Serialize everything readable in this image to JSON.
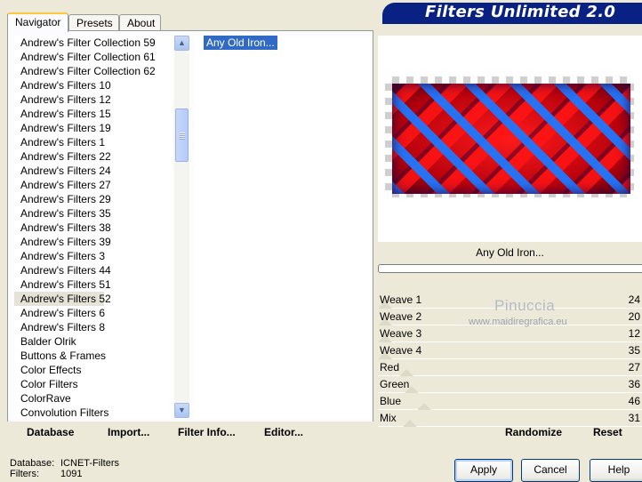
{
  "app": {
    "title": "Filters Unlimited 2.0"
  },
  "tabs": [
    {
      "label": "Navigator",
      "active": true
    },
    {
      "label": "Presets",
      "active": false
    },
    {
      "label": "About",
      "active": false
    }
  ],
  "categories": {
    "items": [
      "Andrew's Filter Collection 59",
      "Andrew's Filter Collection 61",
      "Andrew's Filter Collection 62",
      "Andrew's Filters 10",
      "Andrew's Filters 12",
      "Andrew's Filters 15",
      "Andrew's Filters 19",
      "Andrew's Filters 1",
      "Andrew's Filters 22",
      "Andrew's Filters 24",
      "Andrew's Filters 27",
      "Andrew's Filters 29",
      "Andrew's Filters 35",
      "Andrew's Filters 38",
      "Andrew's Filters 39",
      "Andrew's Filters 3",
      "Andrew's Filters 44",
      "Andrew's Filters 51",
      "Andrew's Filters 52",
      "Andrew's Filters 6",
      "Andrew's Filters 8",
      "Balder Olrik",
      "Buttons & Frames",
      "Color Effects",
      "Color Filters",
      "ColorRave",
      "Convolution Filters"
    ],
    "selected": "Andrew's Filters 52"
  },
  "filters": {
    "items": [
      "Any Old Iron..."
    ],
    "selected": "Any Old Iron..."
  },
  "left_buttons": {
    "database": "Database",
    "import": "Import...",
    "filter_info": "Filter Info...",
    "editor": "Editor..."
  },
  "preview": {
    "filter_name": "Any Old Iron..."
  },
  "parameters": [
    {
      "label": "Weave 1",
      "value": "24"
    },
    {
      "label": "Weave 2",
      "value": "20"
    },
    {
      "label": "Weave 3",
      "value": "12"
    },
    {
      "label": "Weave 4",
      "value": "35"
    },
    {
      "label": "Red",
      "value": "27"
    },
    {
      "label": "Green",
      "value": "36"
    },
    {
      "label": "Blue",
      "value": "46"
    },
    {
      "label": "Mix",
      "value": "31"
    }
  ],
  "watermark": {
    "name": "Pinuccia",
    "url": "www.maidiregrafica.eu"
  },
  "right_buttons": {
    "randomize": "Randomize",
    "reset": "Reset"
  },
  "status": {
    "database_label": "Database:",
    "database_value": "ICNET-Filters",
    "filters_label": "Filters:",
    "filters_value": "1091"
  },
  "dialog_buttons": {
    "apply": "Apply",
    "cancel": "Cancel",
    "help": "Help"
  },
  "colors": {
    "banner": "#0a2184",
    "selection": "#316ac5",
    "window": "#ece9d8"
  }
}
